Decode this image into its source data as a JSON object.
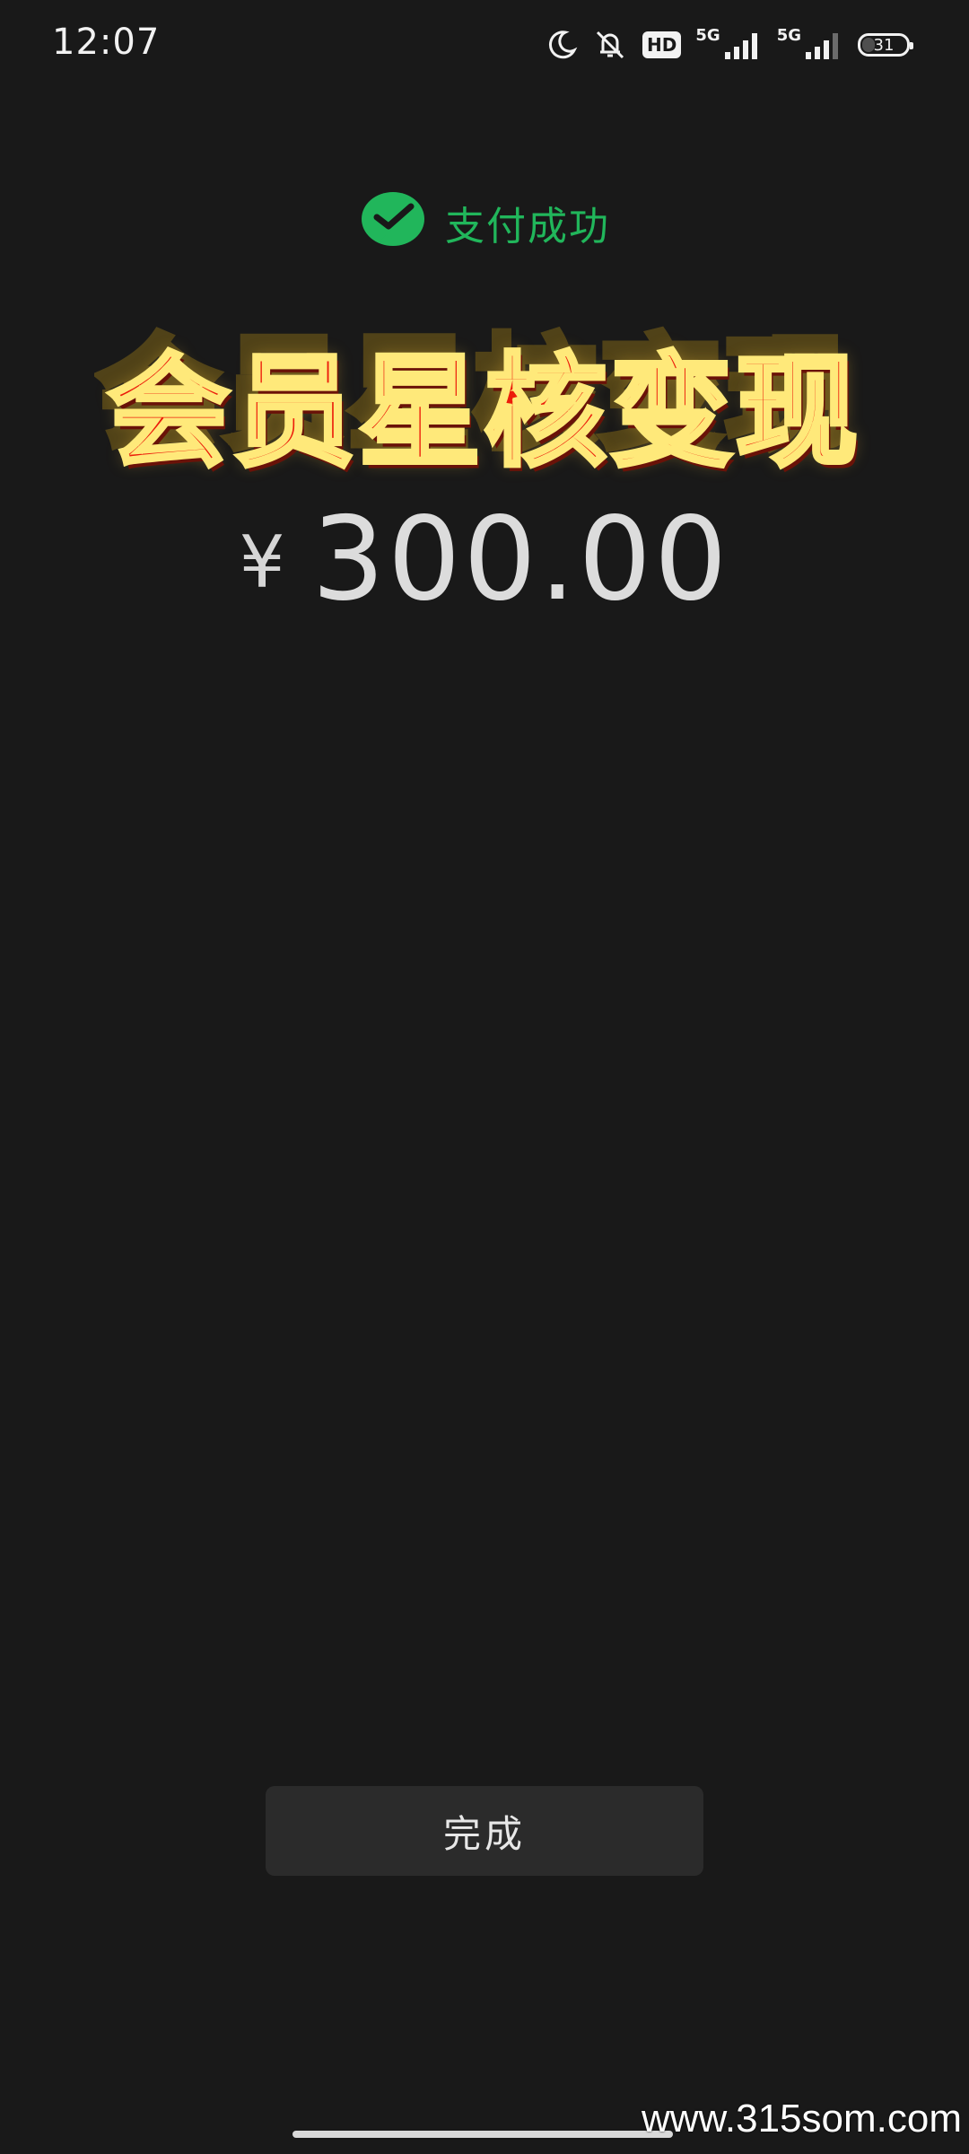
{
  "status_bar": {
    "time": "12:07",
    "icons": [
      "moon-icon",
      "mute-icon",
      "hd-icon",
      "signal-5g-icon",
      "signal-5g-icon",
      "battery-icon"
    ],
    "hd_label": "HD",
    "network_1": "5G",
    "network_2": "5G",
    "battery": "31"
  },
  "payment": {
    "icon": "wechat-pay-icon",
    "status": "支付成功",
    "currency_symbol": "¥",
    "amount": "300.00"
  },
  "overlay": {
    "banner_text": "会员星核变现"
  },
  "actions": {
    "done_label": "完成"
  },
  "watermark": "www.315som.com",
  "colors": {
    "background": "#191919",
    "accent_green": "#21b65b",
    "banner_red": "#ec1c0a",
    "banner_outline": "#ffe97a",
    "button_bg": "#2b2b2b"
  }
}
